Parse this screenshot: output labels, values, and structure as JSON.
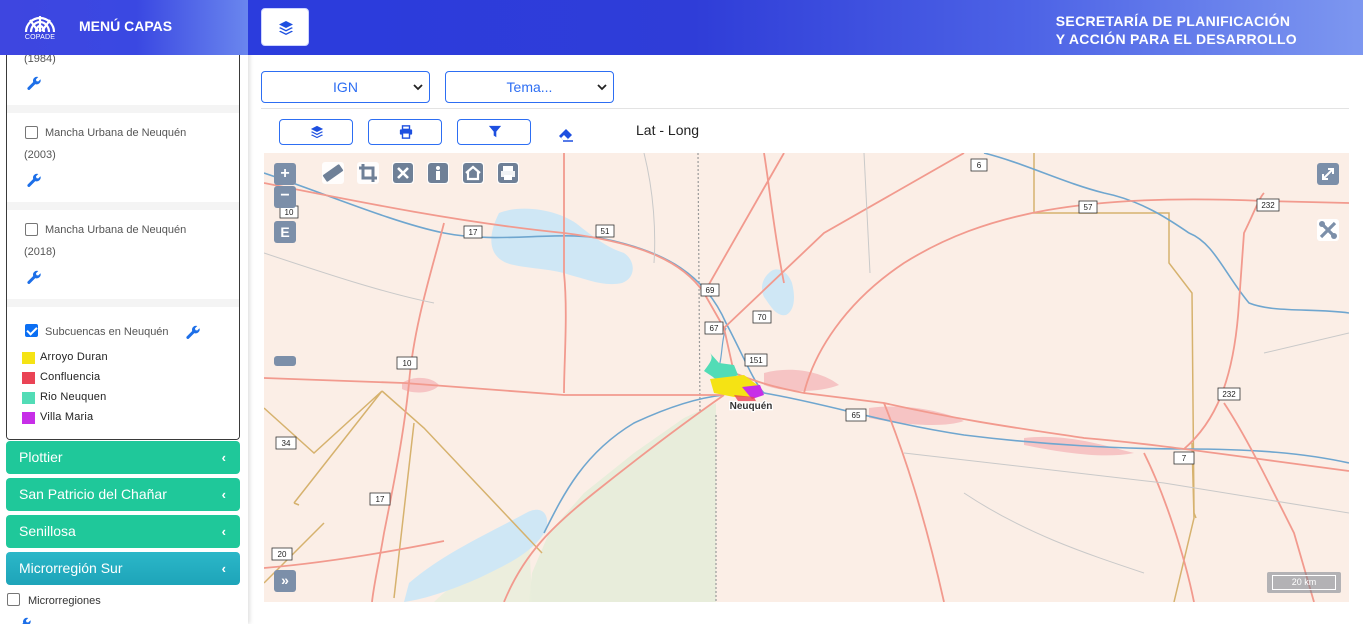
{
  "sidebar": {
    "logo_text": "COPADE",
    "title": "MENÚ CAPAS",
    "layers": {
      "partial_year": "(1984)",
      "mancha_2003": {
        "name": "Mancha Urbana de Neuquén",
        "year": "(2003)",
        "checked": false
      },
      "mancha_2018": {
        "name": "Mancha Urbana de Neuquén",
        "year": "(2018)",
        "checked": false
      },
      "subcuencas": {
        "name": "Subcuencas en Neuquén",
        "checked": true
      }
    },
    "legend": [
      {
        "label": "Arroyo Duran",
        "color": "#f5e314"
      },
      {
        "label": "Confluencia",
        "color": "#ea4355"
      },
      {
        "label": "Rio Neuquen",
        "color": "#52dcb6"
      },
      {
        "label": "Villa Maria",
        "color": "#c72ee8"
      }
    ],
    "accordions": [
      {
        "label": "Plottier"
      },
      {
        "label": "San Patricio del Chañar"
      },
      {
        "label": "Senillosa"
      },
      {
        "label": "Microrregión Sur"
      }
    ],
    "microrregiones": {
      "label": "Microrregiones",
      "checked": false
    }
  },
  "topbar": {
    "title_line1": "SECRETARÍA DE PLANIFICACIÓN",
    "title_line2": "Y ACCIÓN PARA EL DESARROLLO"
  },
  "filters": {
    "base_map": "IGN",
    "theme": "Tema..."
  },
  "toolbar": {
    "coords_label": "Lat - Long"
  },
  "map": {
    "zoom_in": "+",
    "zoom_out": "−",
    "extent_label": "E",
    "expand_label": "»",
    "city_label": "Neuquén",
    "scale_label": "20 km",
    "route_labels": [
      "6",
      "10",
      "17",
      "51",
      "57",
      "232",
      "69",
      "70",
      "67",
      "151",
      "10",
      "65",
      "232",
      "34",
      "17",
      "7",
      "20"
    ]
  }
}
